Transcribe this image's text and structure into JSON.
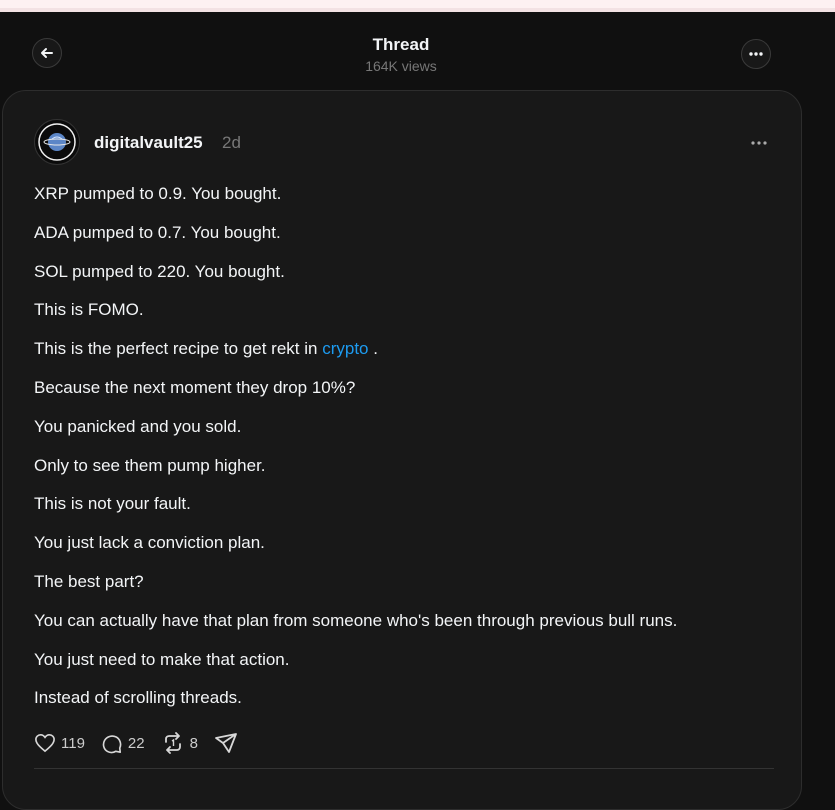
{
  "header": {
    "title": "Thread",
    "views": "164K views"
  },
  "post": {
    "username": "digitalvault25",
    "time": "2d",
    "lines": [
      "XRP pumped to 0.9. You bought.",
      "ADA pumped to 0.7. You bought.",
      "SOL pumped to 220. You bought.",
      "This is FOMO.",
      "This is the perfect recipe to get rekt in",
      "Because the next moment they drop 10%?",
      "You panicked and you sold.",
      "Only to see them pump higher.",
      "This is not your fault.",
      "You just lack a conviction plan.",
      "The best part?",
      "You can actually have that plan from someone who's been through previous bull runs.",
      "You just need to make that action.",
      "Instead of scrolling threads."
    ],
    "link_text": "crypto",
    "link_suffix": " .",
    "likes": "119",
    "replies": "22",
    "reposts": "8"
  },
  "colors": {
    "background": "#101010",
    "card": "#181818",
    "text": "#f3f5f7",
    "muted": "#777777",
    "link": "#1d9bf0"
  },
  "icons": [
    "back-arrow-icon",
    "more-icon",
    "heart-icon",
    "comment-icon",
    "repost-icon",
    "share-icon"
  ]
}
